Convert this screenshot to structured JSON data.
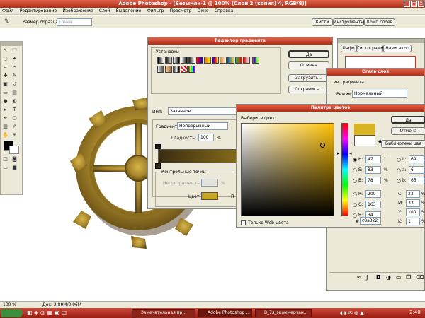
{
  "app": {
    "title": "Adobe Photoshop - [Безымян-1 @ 100% (Слой 2 (копия) 4, RGB/8)]",
    "controls": [
      "_",
      "□",
      "X"
    ]
  },
  "menu": [
    "Файл",
    "Редактирование",
    "Изображение",
    "Слой",
    "Выделение",
    "Фильтр",
    "Просмотр",
    "Окно",
    "Справка"
  ],
  "options_bar": {
    "sample_size_label": "Размер образца:",
    "sample_size_value": "Точка",
    "palette_tabs": [
      "Кисти",
      "Инструменты",
      "Комп.слоев"
    ]
  },
  "gradient_editor": {
    "title": "Редактор градиента",
    "presets_label": "Установки",
    "buttons": {
      "ok": "Да",
      "cancel": "Отмена",
      "load": "Загрузить...",
      "save": "Сохранить..."
    },
    "name_label": "Имя:",
    "name_value": "Заказное",
    "gradient_type_label": "Градиент:",
    "gradient_type_value": "Непрерывный",
    "smoothness_label": "Гладкость:",
    "smoothness_value": "100",
    "smoothness_unit": "%",
    "control_points_label": "Контрольные точки",
    "opacity_label": "Непрозрачность:",
    "opacity_unit": "%",
    "color_label": "Цвет:",
    "position_label_partial": "П",
    "gradient_colors": [
      "#3a2c12",
      "#d8b320"
    ]
  },
  "navigator_palette": {
    "tabs": [
      "Инфо",
      "Гистограмма",
      "Навигатор"
    ]
  },
  "layer_style": {
    "title": "Стиль слоя",
    "section_label": "ие градиента",
    "blend_mode_label": "Режим:",
    "blend_mode_value": "Нормальный",
    "ok_partial": "Да"
  },
  "color_picker": {
    "title": "Палитра цветов",
    "prompt": "Выберите цвет:",
    "buttons": {
      "ok": "Да",
      "cancel": "Отмена",
      "libraries": "Библиотеки цве"
    },
    "new_color": "#d8b322",
    "old_color": "#ffffff",
    "web_only_label": "Только Web-цвета",
    "hsb": [
      {
        "label": "H:",
        "value": "47",
        "unit": "°"
      },
      {
        "label": "S:",
        "value": "83",
        "unit": "%"
      },
      {
        "label": "B:",
        "value": "78",
        "unit": "%"
      }
    ],
    "rgb": [
      {
        "label": "R:",
        "value": "200"
      },
      {
        "label": "G:",
        "value": "163"
      },
      {
        "label": "B:",
        "value": "34"
      }
    ],
    "lab": [
      {
        "label": "L:",
        "value": "69"
      },
      {
        "label": "a:",
        "value": "6"
      },
      {
        "label": "b:",
        "value": "65"
      }
    ],
    "cmyk": [
      {
        "label": "C:",
        "value": "23",
        "unit": "%"
      },
      {
        "label": "M:",
        "value": "33",
        "unit": "%"
      },
      {
        "label": "Y:",
        "value": "100",
        "unit": "%"
      },
      {
        "label": "K:",
        "value": "1",
        "unit": "%"
      }
    ],
    "hex_label": "#",
    "hex_value": "c8a322"
  },
  "status_bar": {
    "zoom": "100 %",
    "doc": "Док: 2,89M/0,96M"
  },
  "taskbar": {
    "items": [
      "Замечательная пр...",
      "Adobe Photoshop ...",
      "В_7я_экоммерчан..."
    ],
    "clock": "2:40"
  },
  "colors": {
    "title_red": "#b22c16",
    "dialog_bg": "#ece9d8",
    "gold": "#c8a322"
  }
}
